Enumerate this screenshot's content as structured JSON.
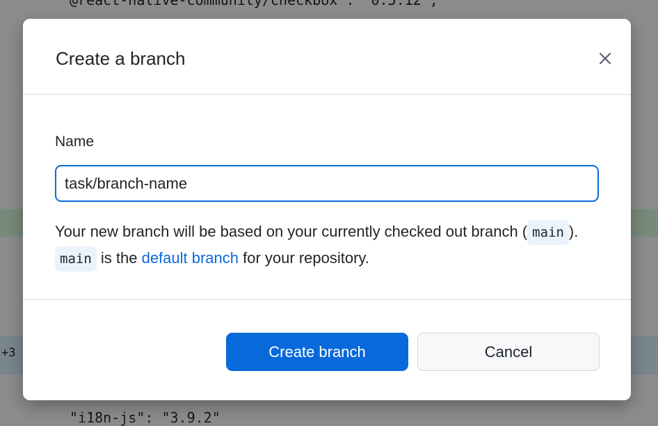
{
  "background": {
    "code_line_top": "@react-native-community/checkbox\": \"0.5.12\",",
    "hunk_label": "+3",
    "code_line_bottom": "\"i18n-js\": \"3.9.2\""
  },
  "dialog": {
    "title": "Create a branch",
    "close_icon": "close-icon",
    "name_label": "Name",
    "name_value": "task/branch-name",
    "note": {
      "part1": "Your new branch will be based on your currently checked out branch (",
      "current_branch": "main",
      "part2": "). ",
      "default_branch_name": "main",
      "part3": " is the ",
      "link_text": "default branch",
      "part4": " for your repository."
    },
    "primary_button": "Create branch",
    "secondary_button": "Cancel"
  },
  "colors": {
    "accent": "#0969da",
    "code_chip_bg": "#eaf3fc",
    "text": "#1f2328"
  }
}
